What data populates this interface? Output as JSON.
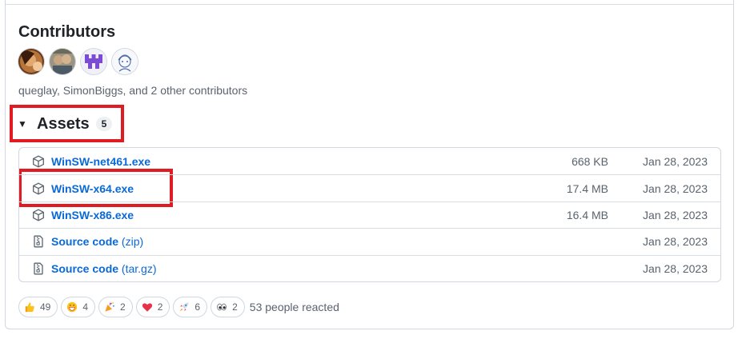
{
  "contributors": {
    "title": "Contributors",
    "summary": "queglay, SimonBiggs, and 2 other contributors",
    "avatars": [
      "queglay",
      "SimonBiggs",
      "contributor-3",
      "contributor-4"
    ]
  },
  "assets": {
    "title": "Assets",
    "count": "5",
    "items": [
      {
        "name": "WinSW-net461.exe",
        "suffix": "",
        "size": "668 KB",
        "date": "Jan 28, 2023",
        "icon": "package-icon"
      },
      {
        "name": "WinSW-x64.exe",
        "suffix": "",
        "size": "17.4 MB",
        "date": "Jan 28, 2023",
        "icon": "package-icon"
      },
      {
        "name": "WinSW-x86.exe",
        "suffix": "",
        "size": "16.4 MB",
        "date": "Jan 28, 2023",
        "icon": "package-icon"
      },
      {
        "name": "Source code",
        "suffix": "(zip)",
        "size": "",
        "date": "Jan 28, 2023",
        "icon": "file-zip-icon"
      },
      {
        "name": "Source code",
        "suffix": "(tar.gz)",
        "size": "",
        "date": "Jan 28, 2023",
        "icon": "file-zip-icon"
      }
    ]
  },
  "reactions": {
    "items": [
      {
        "emoji": "thumbs-up",
        "count": "49"
      },
      {
        "emoji": "laugh",
        "count": "4"
      },
      {
        "emoji": "hooray",
        "count": "2"
      },
      {
        "emoji": "heart",
        "count": "2"
      },
      {
        "emoji": "rocket",
        "count": "6"
      },
      {
        "emoji": "eyes",
        "count": "2"
      }
    ],
    "summary": "53 people reacted"
  },
  "colors": {
    "link": "#0969da",
    "highlight": "#e11b22",
    "muted": "#59636e"
  }
}
